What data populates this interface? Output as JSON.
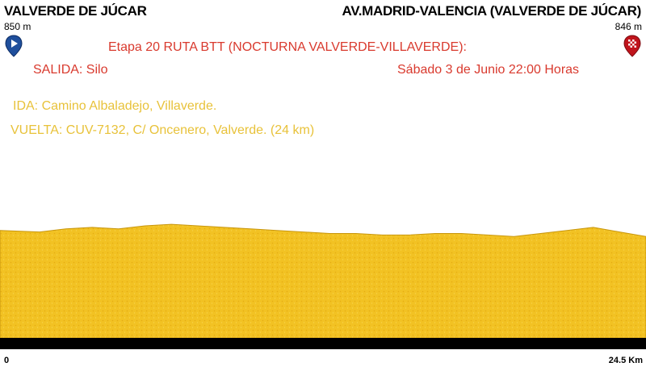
{
  "start": {
    "name": "VALVERDE DE JÚCAR",
    "altitude": "850 m",
    "marker_icon": "play-arrow-icon"
  },
  "finish": {
    "name": "AV.MADRID-VALENCIA (VALVERDE DE JÚCAR)",
    "altitude": "846 m",
    "marker_icon": "checkered-flag-icon"
  },
  "stage_title": "Etapa 20 RUTA BTT (NOCTURNA VALVERDE-VILLAVERDE):",
  "departure": "SALIDA: Silo",
  "date_time": "Sábado 3 de Junio 22:00 Horas",
  "route_out": "IDA: Camino Albaladejo, Villaverde.",
  "route_back": "VUELTA: CUV-7132, C/ Oncenero, Valverde. (24 km)",
  "colors": {
    "title_text": "#d93a2e",
    "route_text": "#e8c23a",
    "profile_fill": "#f0c020",
    "profile_edge": "#c8960c",
    "base_band": "#000000",
    "marker_blue": "#1f4f9c",
    "marker_red": "#c0141c"
  },
  "chart_data": {
    "type": "area",
    "title": "",
    "xlabel": "",
    "ylabel": "",
    "x_tick_labels": [
      "0",
      "24.5 Km"
    ],
    "xlim": [
      0,
      24.5
    ],
    "ylim": [
      780,
      1000
    ],
    "x": [
      0,
      1.5,
      2.5,
      3.5,
      4.5,
      5.5,
      6.5,
      7.5,
      8.5,
      9.5,
      10.5,
      11.5,
      12.5,
      13.5,
      14.5,
      15.5,
      16.5,
      17.5,
      18.5,
      19.5,
      20.5,
      21.5,
      22.5,
      23.5,
      24.5
    ],
    "values": [
      850,
      849,
      851,
      852,
      851,
      853,
      854,
      853,
      852,
      851,
      850,
      849,
      848,
      848,
      847,
      847,
      848,
      848,
      847,
      846,
      848,
      850,
      852,
      849,
      846
    ]
  }
}
